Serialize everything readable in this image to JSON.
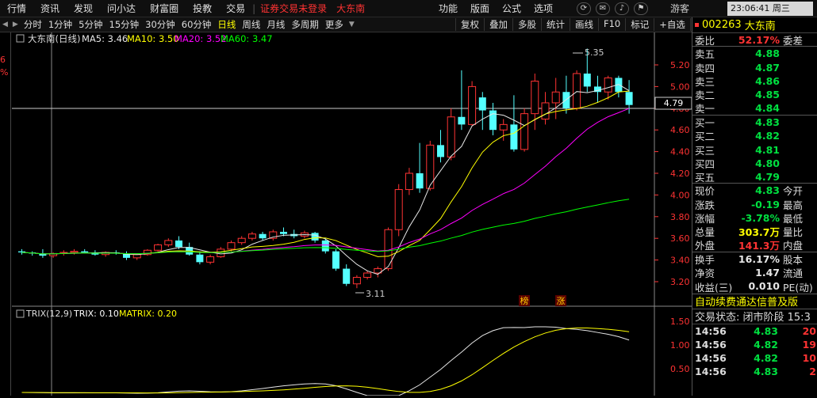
{
  "menubar": {
    "items": [
      "行情",
      "资讯",
      "发现",
      "问小达",
      "财富圈",
      "投教",
      "交易"
    ],
    "notice_trade": "证券交易未登录",
    "notice_stock": "大东南",
    "right_items": [
      "功能",
      "版面",
      "公式",
      "选项"
    ],
    "guest": "游客",
    "time": "23:06:41 周三"
  },
  "toolbar": {
    "periods": [
      "分时",
      "1分钟",
      "5分钟",
      "15分钟",
      "30分钟",
      "60分钟",
      "日线",
      "周线",
      "月线",
      "多周期",
      "更多"
    ],
    "active_period": "日线",
    "buttons": [
      "复权",
      "叠加",
      "多股",
      "统计",
      "画线",
      "F10",
      "标记",
      "+自选",
      "返回"
    ]
  },
  "leftstrip": {
    "values": [
      "6",
      "%"
    ]
  },
  "kline": {
    "title": "大东南(日线)",
    "ma": [
      {
        "label": "MA5: 3.46",
        "color": "#e6e6e6"
      },
      {
        "label": "MA10: 3.50",
        "color": "#ffff00"
      },
      {
        "label": "MA20: 3.52",
        "color": "#ff00ff"
      },
      {
        "label": "MA60: 3.47",
        "color": "#00ff00"
      }
    ],
    "yticks": [
      "5.20",
      "5.00",
      "4.80",
      "4.60",
      "4.40",
      "4.20",
      "4.00",
      "3.80",
      "3.60",
      "3.40",
      "3.20"
    ],
    "cursor_price": "4.79",
    "max_label": "5.35",
    "min_label": "3.11",
    "badges": [
      "榜",
      "涨"
    ]
  },
  "trix": {
    "title": "TRIX(12,9)",
    "trix_label": "TRIX: 0.10",
    "matrix_label": "MATRIX: 0.20",
    "yticks": [
      "1.50",
      "1.00",
      "0.50"
    ]
  },
  "chart_data": {
    "type": "candlestick",
    "title": "大东南(日线)",
    "ylim": [
      3.1,
      5.4
    ],
    "ohlc": [
      [
        3.48,
        3.5,
        3.45,
        3.47
      ],
      [
        3.47,
        3.48,
        3.44,
        3.46
      ],
      [
        3.46,
        3.5,
        3.42,
        3.44
      ],
      [
        3.44,
        3.47,
        3.42,
        3.46
      ],
      [
        3.46,
        3.49,
        3.44,
        3.47
      ],
      [
        3.47,
        3.5,
        3.45,
        3.48
      ],
      [
        3.48,
        3.5,
        3.46,
        3.47
      ],
      [
        3.47,
        3.49,
        3.44,
        3.45
      ],
      [
        3.45,
        3.48,
        3.43,
        3.47
      ],
      [
        3.47,
        3.49,
        3.45,
        3.46
      ],
      [
        3.46,
        3.48,
        3.4,
        3.42
      ],
      [
        3.42,
        3.46,
        3.4,
        3.45
      ],
      [
        3.45,
        3.5,
        3.44,
        3.49
      ],
      [
        3.49,
        3.55,
        3.48,
        3.54
      ],
      [
        3.54,
        3.6,
        3.52,
        3.58
      ],
      [
        3.58,
        3.62,
        3.5,
        3.52
      ],
      [
        3.52,
        3.56,
        3.44,
        3.45
      ],
      [
        3.45,
        3.48,
        3.36,
        3.38
      ],
      [
        3.38,
        3.45,
        3.36,
        3.43
      ],
      [
        3.43,
        3.52,
        3.42,
        3.5
      ],
      [
        3.5,
        3.58,
        3.48,
        3.56
      ],
      [
        3.56,
        3.62,
        3.54,
        3.6
      ],
      [
        3.6,
        3.66,
        3.58,
        3.64
      ],
      [
        3.64,
        3.66,
        3.58,
        3.6
      ],
      [
        3.6,
        3.68,
        3.58,
        3.66
      ],
      [
        3.66,
        3.7,
        3.62,
        3.64
      ],
      [
        3.64,
        3.68,
        3.6,
        3.62
      ],
      [
        3.62,
        3.67,
        3.6,
        3.65
      ],
      [
        3.65,
        3.66,
        3.56,
        3.58
      ],
      [
        3.58,
        3.6,
        3.46,
        3.48
      ],
      [
        3.48,
        3.5,
        3.3,
        3.32
      ],
      [
        3.32,
        3.36,
        3.16,
        3.18
      ],
      [
        3.18,
        3.26,
        3.14,
        3.24
      ],
      [
        3.24,
        3.3,
        3.22,
        3.28
      ],
      [
        3.28,
        3.34,
        3.24,
        3.32
      ],
      [
        3.32,
        3.7,
        3.3,
        3.68
      ],
      [
        3.68,
        4.1,
        3.62,
        4.05
      ],
      [
        4.05,
        4.25,
        4.0,
        4.2
      ],
      [
        4.2,
        4.48,
        4.02,
        4.06
      ],
      [
        4.06,
        4.5,
        4.04,
        4.46
      ],
      [
        4.46,
        4.6,
        4.3,
        4.35
      ],
      [
        4.35,
        4.8,
        4.32,
        4.72
      ],
      [
        4.72,
        5.15,
        4.6,
        4.65
      ],
      [
        4.65,
        5.05,
        4.64,
        5.0
      ],
      [
        4.9,
        4.95,
        4.6,
        4.78
      ],
      [
        4.78,
        4.85,
        4.55,
        4.6
      ],
      [
        4.6,
        4.7,
        4.5,
        4.65
      ],
      [
        4.65,
        4.92,
        4.4,
        4.42
      ],
      [
        4.42,
        4.8,
        4.4,
        4.75
      ],
      [
        4.75,
        5.12,
        4.6,
        5.05
      ],
      [
        4.7,
        4.95,
        4.65,
        4.85
      ],
      [
        4.85,
        5.08,
        4.7,
        4.95
      ],
      [
        4.95,
        5.1,
        4.75,
        4.8
      ],
      [
        4.8,
        5.15,
        4.78,
        5.12
      ],
      [
        5.12,
        5.35,
        4.95,
        5.0
      ],
      [
        5.0,
        5.1,
        4.85,
        4.95
      ],
      [
        4.95,
        5.1,
        4.88,
        5.08
      ],
      [
        5.08,
        5.1,
        4.9,
        4.95
      ],
      [
        4.95,
        5.06,
        4.75,
        4.83
      ]
    ]
  },
  "quote": {
    "code": "002263",
    "name": "大东南",
    "weibi_label": "委比",
    "weibi": "52.17%",
    "weicha_label": "委差",
    "asks": [
      {
        "label": "卖五",
        "price": "4.88"
      },
      {
        "label": "卖四",
        "price": "4.87"
      },
      {
        "label": "卖三",
        "price": "4.86"
      },
      {
        "label": "卖二",
        "price": "4.85"
      },
      {
        "label": "卖一",
        "price": "4.84"
      }
    ],
    "bids": [
      {
        "label": "买一",
        "price": "4.83"
      },
      {
        "label": "买二",
        "price": "4.82"
      },
      {
        "label": "买三",
        "price": "4.81"
      },
      {
        "label": "买四",
        "price": "4.80"
      },
      {
        "label": "买五",
        "price": "4.79"
      }
    ],
    "stats": [
      {
        "l": "现价",
        "v": "4.83",
        "r": "今开",
        "cls": "green"
      },
      {
        "l": "涨跌",
        "v": "-0.19",
        "r": "最高",
        "cls": "green"
      },
      {
        "l": "涨幅",
        "v": "-3.78%",
        "r": "最低",
        "cls": "green"
      },
      {
        "l": "总量",
        "v": "303.7万",
        "r": "量比",
        "cls": "yellow"
      },
      {
        "l": "外盘",
        "v": "141.3万",
        "r": "内盘",
        "cls": "red"
      }
    ],
    "stats2": [
      {
        "l": "换手",
        "v": "16.17%",
        "r": "股本"
      },
      {
        "l": "净资",
        "v": "1.47",
        "r": "流通"
      },
      {
        "l": "收益(三)",
        "v": "0.010",
        "r": "PE(动)"
      }
    ],
    "banner": "自动续费通达信普及版",
    "status": "交易状态: 闭市阶段 15:3",
    "ticks": [
      {
        "t": "14:56",
        "p": "4.83",
        "v": "20"
      },
      {
        "t": "14:56",
        "p": "4.82",
        "v": "19"
      },
      {
        "t": "14:56",
        "p": "4.82",
        "v": "10"
      },
      {
        "t": "14:56",
        "p": "4.83",
        "v": "2"
      }
    ]
  }
}
